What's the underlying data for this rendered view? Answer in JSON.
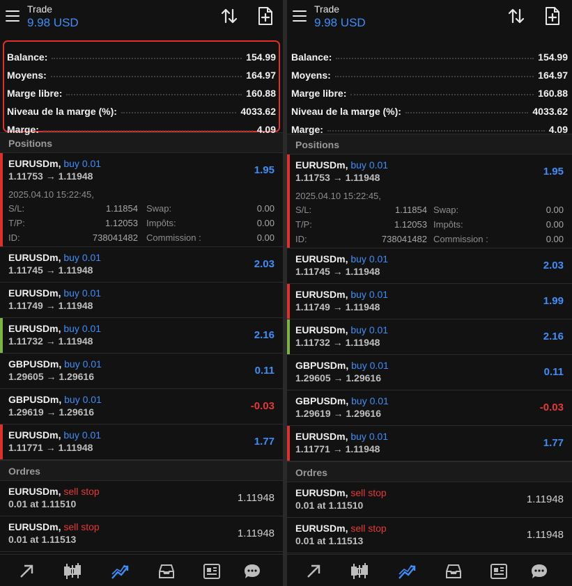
{
  "header": {
    "title": "Trade",
    "subtitle": "9.98 USD"
  },
  "summary": [
    {
      "label": "Balance:",
      "value": "154.99"
    },
    {
      "label": "Moyens:",
      "value": "164.97"
    },
    {
      "label": "Marge libre:",
      "value": "160.88"
    },
    {
      "label": "Niveau de la marge (%):",
      "value": "4033.62"
    },
    {
      "label": "Marge:",
      "value": "4.09"
    }
  ],
  "positions_label": "Positions",
  "orders_label": "Ordres",
  "expanded": {
    "datetime": "2025.04.10 15:22:45,",
    "rows": [
      {
        "k1": "S/L:",
        "v1": "1.11854",
        "k2": "Swap:",
        "v2": "0.00"
      },
      {
        "k1": "T/P:",
        "v1": "1.12053",
        "k2": "Impôts:",
        "v2": "0.00"
      },
      {
        "k1": "ID:",
        "v1": "738041482",
        "k2": "Commission :",
        "v2": "0.00"
      }
    ]
  },
  "left_positions": [
    {
      "symbol": "EURUSDm,",
      "side": "buy 0.01",
      "prices": "1.11753 → 1.11948",
      "pl": "1.95"
    },
    {
      "symbol": "EURUSDm,",
      "side": "buy 0.01",
      "prices": "1.11745 → 1.11948",
      "pl": "2.03"
    },
    {
      "symbol": "EURUSDm,",
      "side": "buy 0.01",
      "prices": "1.11749 → 1.11948",
      "pl": ""
    },
    {
      "symbol": "EURUSDm,",
      "side": "buy 0.01",
      "prices": "1.11732 → 1.11948",
      "pl": "2.16"
    },
    {
      "symbol": "GBPUSDm,",
      "side": "buy 0.01",
      "prices": "1.29605 → 1.29616",
      "pl": "0.11"
    },
    {
      "symbol": "GBPUSDm,",
      "side": "buy 0.01",
      "prices": "1.29619 → 1.29616",
      "pl": "-0.03"
    },
    {
      "symbol": "EURUSDm,",
      "side": "buy 0.01",
      "prices": "1.11771 → 1.11948",
      "pl": "1.77"
    }
  ],
  "right_positions": [
    {
      "symbol": "EURUSDm,",
      "side": "buy 0.01",
      "prices": "1.11753 → 1.11948",
      "pl": "1.95"
    },
    {
      "symbol": "EURUSDm,",
      "side": "buy 0.01",
      "prices": "1.11745 → 1.11948",
      "pl": "2.03"
    },
    {
      "symbol": "EURUSDm,",
      "side": "buy 0.01",
      "prices": "1.11749 → 1.11948",
      "pl": "1.99"
    },
    {
      "symbol": "EURUSDm,",
      "side": "buy 0.01",
      "prices": "1.11732 → 1.11948",
      "pl": "2.16"
    },
    {
      "symbol": "GBPUSDm,",
      "side": "buy 0.01",
      "prices": "1.29605 → 1.29616",
      "pl": "0.11"
    },
    {
      "symbol": "GBPUSDm,",
      "side": "buy 0.01",
      "prices": "1.29619 → 1.29616",
      "pl": "-0.03"
    },
    {
      "symbol": "EURUSDm,",
      "side": "buy 0.01",
      "prices": "1.11771 → 1.11948",
      "pl": "1.77"
    }
  ],
  "orders": [
    {
      "symbol": "EURUSDm,",
      "side": "sell stop",
      "detail": "0.01 at 1.11510",
      "price": "1.11948"
    },
    {
      "symbol": "EURUSDm,",
      "side": "sell stop",
      "detail": "0.01 at 1.11513",
      "price": "1.11948"
    }
  ],
  "colors": {
    "accent": "#3d8ef8",
    "negative": "#e53935",
    "highlight_border": "#e0302c",
    "bar_red": "#e0302c",
    "bar_green": "#7cb342",
    "background": "#121212"
  },
  "left_bars": [
    "#e0302c",
    "",
    "",
    "#7cb342",
    "",
    "",
    "#e0302c"
  ],
  "right_bars": [
    "#e0302c",
    "",
    "#e0302c",
    "#7cb342",
    "",
    "",
    "#e0302c"
  ],
  "nav_icons": [
    "quotes-arrows-icon",
    "chart-candles-icon",
    "trade-trend-icon",
    "history-inbox-icon",
    "news-icon",
    "chat-icon"
  ]
}
